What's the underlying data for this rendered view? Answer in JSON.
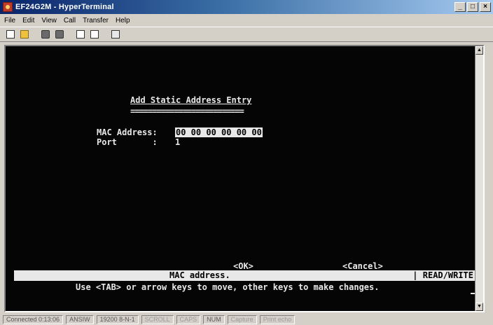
{
  "window": {
    "title": "EF24G2M - HyperTerminal",
    "controls": [
      "_",
      "□",
      "×"
    ]
  },
  "menu": [
    "File",
    "Edit",
    "View",
    "Call",
    "Transfer",
    "Help"
  ],
  "toolbar": {
    "icons": [
      "new-icon",
      "open-folder-icon",
      "connect-phone-icon",
      "disconnect-icon",
      "send-icon",
      "receive-icon",
      "properties-icon"
    ]
  },
  "terminal": {
    "form_title": "Add Static Address Entry",
    "form_underline": "==========================",
    "mac_label": "MAC Address:",
    "mac_value": "00 00 00 00 00 00",
    "port_label": "Port       :",
    "port_value": "1",
    "ok_label": "<OK>",
    "cancel_label": "<Cancel>",
    "status_message": "MAC address.",
    "mode": "| READ/WRITE",
    "help": "Use <TAB> or arrow keys to move, other keys to make changes."
  },
  "statusbar": {
    "connected": "Connected 0:13:06",
    "emulation": "ANSIW",
    "settings": "19200 8-N-1",
    "scroll": "SCROLL",
    "caps": "CAPS",
    "num": "NUM",
    "capture": "Capture",
    "print_echo": "Print echo"
  },
  "colors": {
    "title_start": "#0a246a",
    "title_end": "#a6caf0",
    "terminal_bg": "#050505",
    "terminal_fg": "#e8e8e8"
  }
}
